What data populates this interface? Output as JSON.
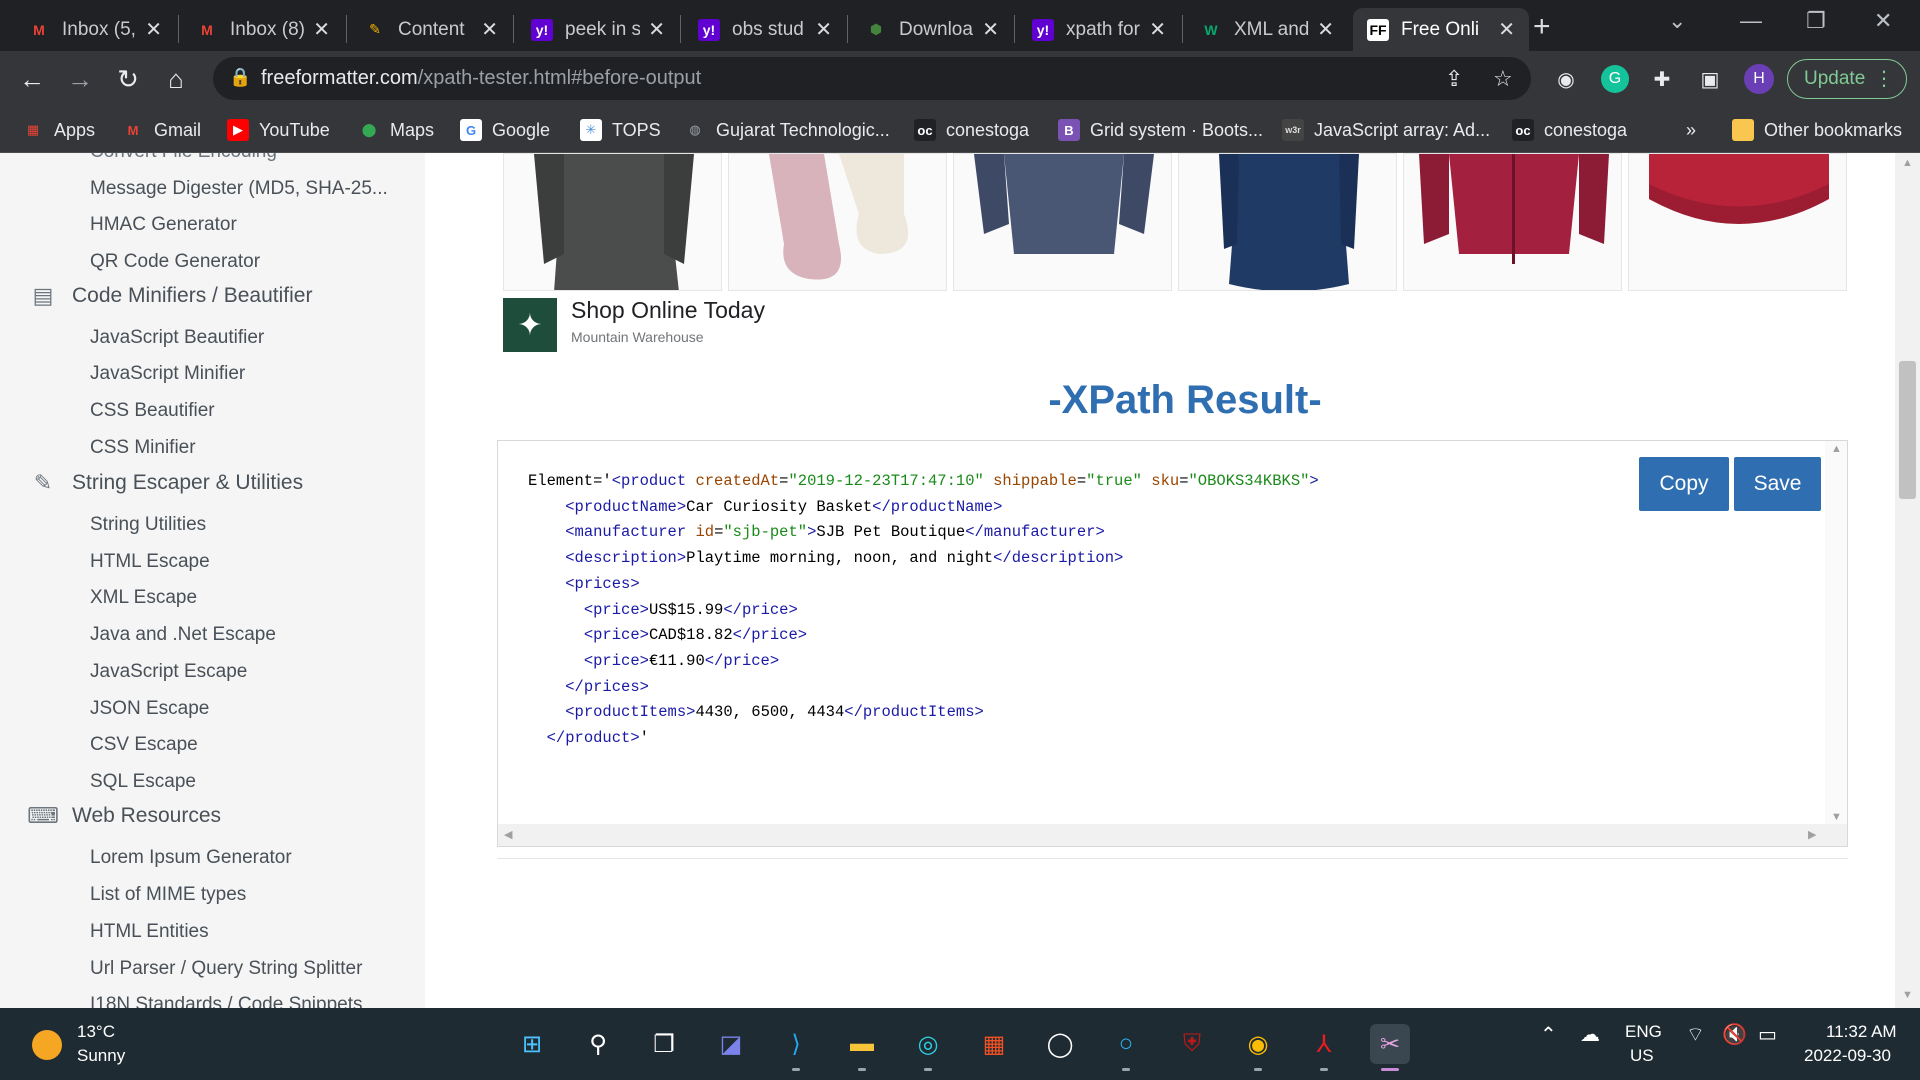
{
  "browser": {
    "tabs": [
      {
        "title": "Inbox (5,",
        "favicon": "gmail-icon",
        "color": "#ea4335"
      },
      {
        "title": "Inbox (8)",
        "favicon": "gmail-icon",
        "color": "#ea4335"
      },
      {
        "title": "Content",
        "favicon": "notes-icon",
        "color": "#f4b400"
      },
      {
        "title": "peek in s",
        "favicon": "yahoo-icon",
        "color": "#6001d2"
      },
      {
        "title": "obs stud",
        "favicon": "yahoo-icon",
        "color": "#6001d2"
      },
      {
        "title": "Downloa",
        "favicon": "node-icon",
        "color": "#43853d"
      },
      {
        "title": "xpath for",
        "favicon": "yahoo-icon",
        "color": "#6001d2"
      },
      {
        "title": "XML and",
        "favicon": "w3-icon",
        "color": "#04aa6d"
      },
      {
        "title": "Free Onli",
        "favicon": "ff-icon",
        "color": "#ffffff"
      }
    ],
    "url_domain": "freeformatter.com",
    "url_path": "/xpath-tester.html#before-output",
    "update_label": "Update",
    "profile_initial": "H",
    "bookmarks": [
      {
        "label": "Apps",
        "icon": "apps-grid-icon"
      },
      {
        "label": "Gmail",
        "icon": "gmail-icon"
      },
      {
        "label": "YouTube",
        "icon": "youtube-icon"
      },
      {
        "label": "Maps",
        "icon": "maps-icon"
      },
      {
        "label": "Google",
        "icon": "google-icon"
      },
      {
        "label": "TOPS",
        "icon": "tops-icon"
      },
      {
        "label": "Gujarat Technologic...",
        "icon": "globe-icon"
      },
      {
        "label": "conestoga",
        "icon": "conestoga-icon"
      },
      {
        "label": "Grid system · Boots...",
        "icon": "bootstrap-icon"
      },
      {
        "label": "JavaScript array: Ad...",
        "icon": "w3r-icon"
      },
      {
        "label": "conestoga",
        "icon": "conestoga-icon"
      }
    ],
    "more_bookmarks": "»",
    "other_bookmarks": "Other bookmarks"
  },
  "sidebar": {
    "partial_top": "Convert File Encoding",
    "items_top": [
      "Message Digester (MD5, SHA-25...",
      "HMAC Generator",
      "QR Code Generator"
    ],
    "cat_minifiers": "Code Minifiers / Beautifier",
    "items_minifiers": [
      "JavaScript Beautifier",
      "JavaScript Minifier",
      "CSS Beautifier",
      "CSS Minifier"
    ],
    "cat_escaper": "String Escaper & Utilities",
    "items_escaper": [
      "String Utilities",
      "HTML Escape",
      "XML Escape",
      "Java and .Net Escape",
      "JavaScript Escape",
      "JSON Escape",
      "CSV Escape",
      "SQL Escape"
    ],
    "cat_web": "Web Resources",
    "items_web": [
      "Lorem Ipsum Generator",
      "List of MIME types",
      "HTML Entities",
      "Url Parser / Query String Splitter",
      "I18N Standards / Code Snippets"
    ]
  },
  "ad": {
    "title": "Shop Online Today",
    "advertiser": "Mountain Warehouse",
    "products": [
      "jacket",
      "socks",
      "coat",
      "parka",
      "rain-jacket",
      "beanie"
    ]
  },
  "result": {
    "heading": "-XPath Result-",
    "copy_label": "Copy",
    "save_label": "Save",
    "lines": [
      {
        "indent": "",
        "parts": [
          [
            "t",
            "Element='"
          ],
          [
            "g",
            "<product "
          ],
          [
            "a",
            "createdAt"
          ],
          [
            "t",
            "="
          ],
          [
            "v",
            "\"2019-12-23T17:47:10\""
          ],
          [
            "t",
            " "
          ],
          [
            "a",
            "shippable"
          ],
          [
            "t",
            "="
          ],
          [
            "v",
            "\"true\""
          ],
          [
            "t",
            " "
          ],
          [
            "a",
            "sku"
          ],
          [
            "t",
            "="
          ],
          [
            "v",
            "\"OBOKS34KBKS\""
          ],
          [
            "g",
            ">"
          ]
        ]
      },
      {
        "indent": "    ",
        "parts": [
          [
            "g",
            "<productName>"
          ],
          [
            "t",
            "Car Curiosity Basket"
          ],
          [
            "g",
            "</productName>"
          ]
        ]
      },
      {
        "indent": "    ",
        "parts": [
          [
            "g",
            "<manufacturer "
          ],
          [
            "a",
            "id"
          ],
          [
            "t",
            "="
          ],
          [
            "v",
            "\"sjb-pet\""
          ],
          [
            "g",
            ">"
          ],
          [
            "t",
            "SJB Pet Boutique"
          ],
          [
            "g",
            "</manufacturer>"
          ]
        ]
      },
      {
        "indent": "    ",
        "parts": [
          [
            "g",
            "<description>"
          ],
          [
            "t",
            "Playtime morning, noon, and night"
          ],
          [
            "g",
            "</description>"
          ]
        ]
      },
      {
        "indent": "    ",
        "parts": [
          [
            "g",
            "<prices>"
          ]
        ]
      },
      {
        "indent": "      ",
        "parts": [
          [
            "g",
            "<price>"
          ],
          [
            "t",
            "US$15.99"
          ],
          [
            "g",
            "</price>"
          ]
        ]
      },
      {
        "indent": "      ",
        "parts": [
          [
            "g",
            "<price>"
          ],
          [
            "t",
            "CAD$18.82"
          ],
          [
            "g",
            "</price>"
          ]
        ]
      },
      {
        "indent": "      ",
        "parts": [
          [
            "g",
            "<price>"
          ],
          [
            "t",
            "€11.90"
          ],
          [
            "g",
            "</price>"
          ]
        ]
      },
      {
        "indent": "    ",
        "parts": [
          [
            "g",
            "</prices>"
          ]
        ]
      },
      {
        "indent": "    ",
        "parts": [
          [
            "g",
            "<productItems>"
          ],
          [
            "t",
            "4430, 6500, 4434"
          ],
          [
            "g",
            "</productItems>"
          ]
        ]
      },
      {
        "indent": "  ",
        "parts": [
          [
            "g",
            "</product>"
          ],
          [
            "t",
            "'"
          ]
        ]
      }
    ]
  },
  "taskbar": {
    "temperature": "13°C",
    "condition": "Sunny",
    "lang": "ENG",
    "region": "US",
    "time": "11:32 AM",
    "date": "2022-09-30",
    "apps": [
      "windows-start-icon",
      "search-icon",
      "task-view-icon",
      "chat-icon",
      "vscode-icon",
      "file-explorer-icon",
      "edge-icon",
      "store-icon",
      "dell-icon",
      "cortana-icon",
      "mcafee-icon",
      "chrome-icon",
      "acrobat-icon",
      "snipping-tool-icon"
    ]
  }
}
